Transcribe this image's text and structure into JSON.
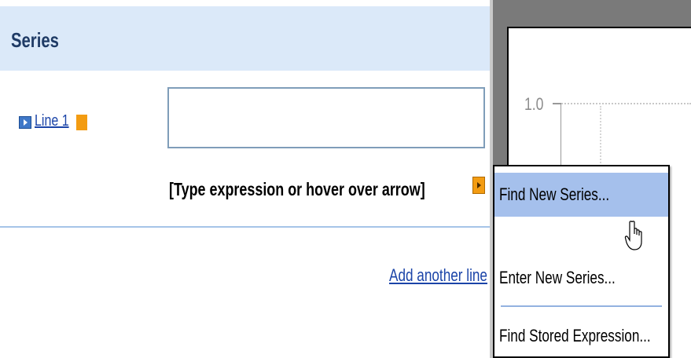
{
  "series_panel": {
    "title": "Series",
    "line": {
      "label": "Line 1",
      "color": "#f39c12"
    },
    "expression_input": {
      "value": "",
      "placeholder": ""
    },
    "hint": "[Type expression or hover over arrow]",
    "add_line_label": "Add another line"
  },
  "chart": {
    "y_tick_label": "1.0"
  },
  "context_menu": {
    "items": [
      {
        "label": "Find New Series..."
      },
      {
        "label": "Enter New Series..."
      },
      {
        "label": "Find Stored Expression..."
      }
    ],
    "highlight_color": "#a5c0ec"
  },
  "icons": {
    "expand": "expand-arrow-icon",
    "menu_arrow": "menu-arrow-icon",
    "cursor": "hand-pointer-icon"
  }
}
